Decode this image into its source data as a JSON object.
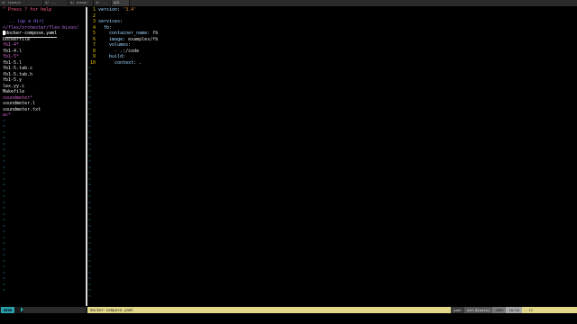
{
  "tabs": [
    {
      "label": "4/ lions/c"
    },
    {
      "label": "4/ ..."
    },
    {
      "label": "4/ (none)"
    },
    {
      "label": "4/ ..."
    },
    {
      "label": "4/2"
    }
  ],
  "tree": {
    "help": "\" Press ? for help",
    "up": ".. (up a dir)",
    "root": "</flex/orchestar/flex-bison/",
    "items": [
      {
        "name": "docker-compose.yaml",
        "kind": "selected"
      },
      {
        "name": "Dockerfile",
        "kind": "file"
      },
      {
        "name": "fb1-4*",
        "kind": "dir"
      },
      {
        "name": "fb1-4.l",
        "kind": "file"
      },
      {
        "name": "fb1-5*",
        "kind": "dir"
      },
      {
        "name": "fb1-5.l",
        "kind": "file"
      },
      {
        "name": "fb1-5.tab.c",
        "kind": "file"
      },
      {
        "name": "fb1-5.tab.h",
        "kind": "file"
      },
      {
        "name": "fb1-5.y",
        "kind": "file"
      },
      {
        "name": "lex.yy.c",
        "kind": "file"
      },
      {
        "name": "Makefile",
        "kind": "file"
      },
      {
        "name": "soundmeter*",
        "kind": "dir"
      },
      {
        "name": "soundmeter.l",
        "kind": "file"
      },
      {
        "name": "soundmeter.txt",
        "kind": "file"
      },
      {
        "name": "wc*",
        "kind": "dir"
      }
    ],
    "tilde": "~"
  },
  "editor": {
    "lines": [
      {
        "num": "1",
        "key": "version",
        "sep": ": ",
        "val": "'3.4'",
        "valtype": "str"
      },
      {
        "num": "2",
        "key": "",
        "sep": "",
        "val": "",
        "valtype": "plain"
      },
      {
        "num": "3",
        "key": "services",
        "sep": ":",
        "val": "",
        "valtype": "plain"
      },
      {
        "num": "4",
        "key": "  fb",
        "sep": ":",
        "val": "",
        "valtype": "plain"
      },
      {
        "num": "5",
        "key": "    container_name",
        "sep": ": ",
        "val": "fb",
        "valtype": "plain"
      },
      {
        "num": "6",
        "key": "    image",
        "sep": ": ",
        "val": "examples/fb",
        "valtype": "plain"
      },
      {
        "num": "7",
        "key": "    volumes",
        "sep": ":",
        "val": "",
        "valtype": "plain"
      },
      {
        "num": "8",
        "key": "      - ",
        "sep": "",
        "val": ".:/code",
        "valtype": "plain"
      },
      {
        "num": "9",
        "key": "    build",
        "sep": ":",
        "val": "",
        "valtype": "plain"
      },
      {
        "num": "10",
        "key": "      context",
        "sep": ": ",
        "val": ".",
        "valtype": "plain"
      }
    ],
    "tilde": "~"
  },
  "status": {
    "mode": "NERD",
    "filename": "docker-compose.yaml",
    "filetype": "yaml",
    "encoding": "utf-8[unix]",
    "percent": "100%",
    "position": "10/10",
    "column": ": 12"
  }
}
